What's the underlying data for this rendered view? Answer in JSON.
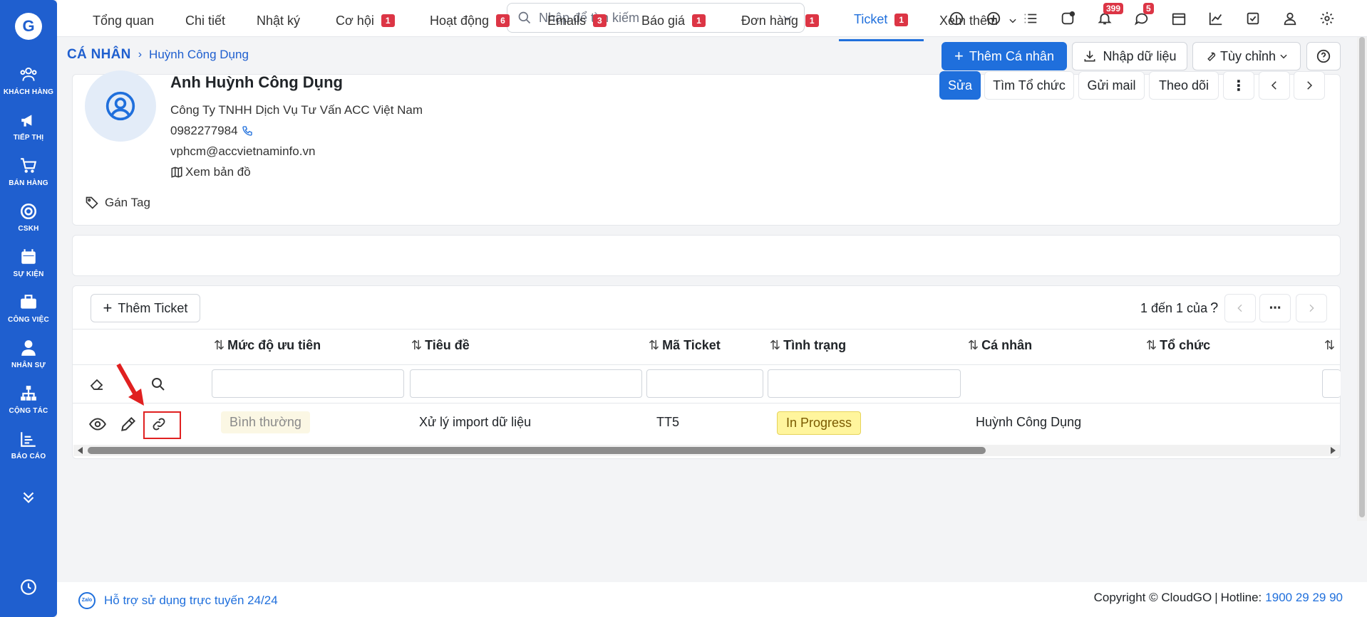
{
  "sidebar": {
    "logo": "G",
    "items": [
      {
        "label": "KHÁCH HÀNG",
        "icon": "users-icon"
      },
      {
        "label": "TIẾP THỊ",
        "icon": "megaphone-icon"
      },
      {
        "label": "BÁN HÀNG",
        "icon": "cart-icon"
      },
      {
        "label": "CSKH",
        "icon": "lifebuoy-icon"
      },
      {
        "label": "SỰ KIỆN",
        "icon": "calendar-icon"
      },
      {
        "label": "CÔNG VIỆC",
        "icon": "briefcase-icon"
      },
      {
        "label": "NHÂN SỰ",
        "icon": "person-icon"
      },
      {
        "label": "CỘNG TÁC",
        "icon": "sitemap-icon"
      },
      {
        "label": "BÁO CÁO",
        "icon": "report-icon"
      }
    ]
  },
  "topbar": {
    "search_placeholder": "Nhập để tìm kiếm",
    "notifications_count": "399",
    "messages_count": "5"
  },
  "breadcrumb": {
    "root": "CÁ NHÂN",
    "current": "Huỳnh Công Dụng"
  },
  "header_actions": {
    "add": "Thêm Cá nhân",
    "import": "Nhập dữ liệu",
    "customize": "Tùy chỉnh"
  },
  "profile": {
    "name": "Anh Huỳnh Công Dụng",
    "company": "Công Ty TNHH Dịch Vụ Tư Vấn ACC Việt Nam",
    "phone": "0982277984",
    "email": "vphcm@accvietnaminfo.vn",
    "map_link": "Xem bản đồ",
    "tag_label": "Gán Tag"
  },
  "profile_actions": {
    "edit": "Sửa",
    "find_org": "Tìm Tổ chức",
    "send_mail": "Gửi mail",
    "follow": "Theo dõi"
  },
  "tabs": [
    {
      "label": "Tổng quan",
      "count": ""
    },
    {
      "label": "Chi tiết",
      "count": ""
    },
    {
      "label": "Nhật ký",
      "count": ""
    },
    {
      "label": "Cơ hội",
      "count": "1"
    },
    {
      "label": "Hoạt động",
      "count": "6"
    },
    {
      "label": "Emails",
      "count": "3"
    },
    {
      "label": "Báo giá",
      "count": "1"
    },
    {
      "label": "Đơn hàng",
      "count": "1"
    },
    {
      "label": "Ticket",
      "count": "1"
    },
    {
      "label": "Xem thêm",
      "count": ""
    }
  ],
  "ticket_panel": {
    "add_button": "Thêm Ticket",
    "pager_text": "1 đến 1 của",
    "pager_q": "?",
    "columns": [
      "Mức độ ưu tiên",
      "Tiêu đề",
      "Mã Ticket",
      "Tình trạng",
      "Cá nhân",
      "Tổ chức"
    ],
    "rows": [
      {
        "priority": "Bình thường",
        "title": "Xử lý import dữ liệu",
        "code": "TT5",
        "status": "In Progress",
        "person": "Huỳnh Công Dụng",
        "org": ""
      }
    ]
  },
  "footer": {
    "support": "Hỗ trợ sử dụng trực tuyến 24/24",
    "zalo": "Zalo",
    "copyright": "Copyright © CloudGO",
    "hotline_label": "Hotline:",
    "hotline": "1900 29 29 90"
  },
  "colors": {
    "brand": "#1f5fcf",
    "primary": "#1f6fdc",
    "badge": "#dc3545",
    "status_bg": "#fff59d"
  }
}
